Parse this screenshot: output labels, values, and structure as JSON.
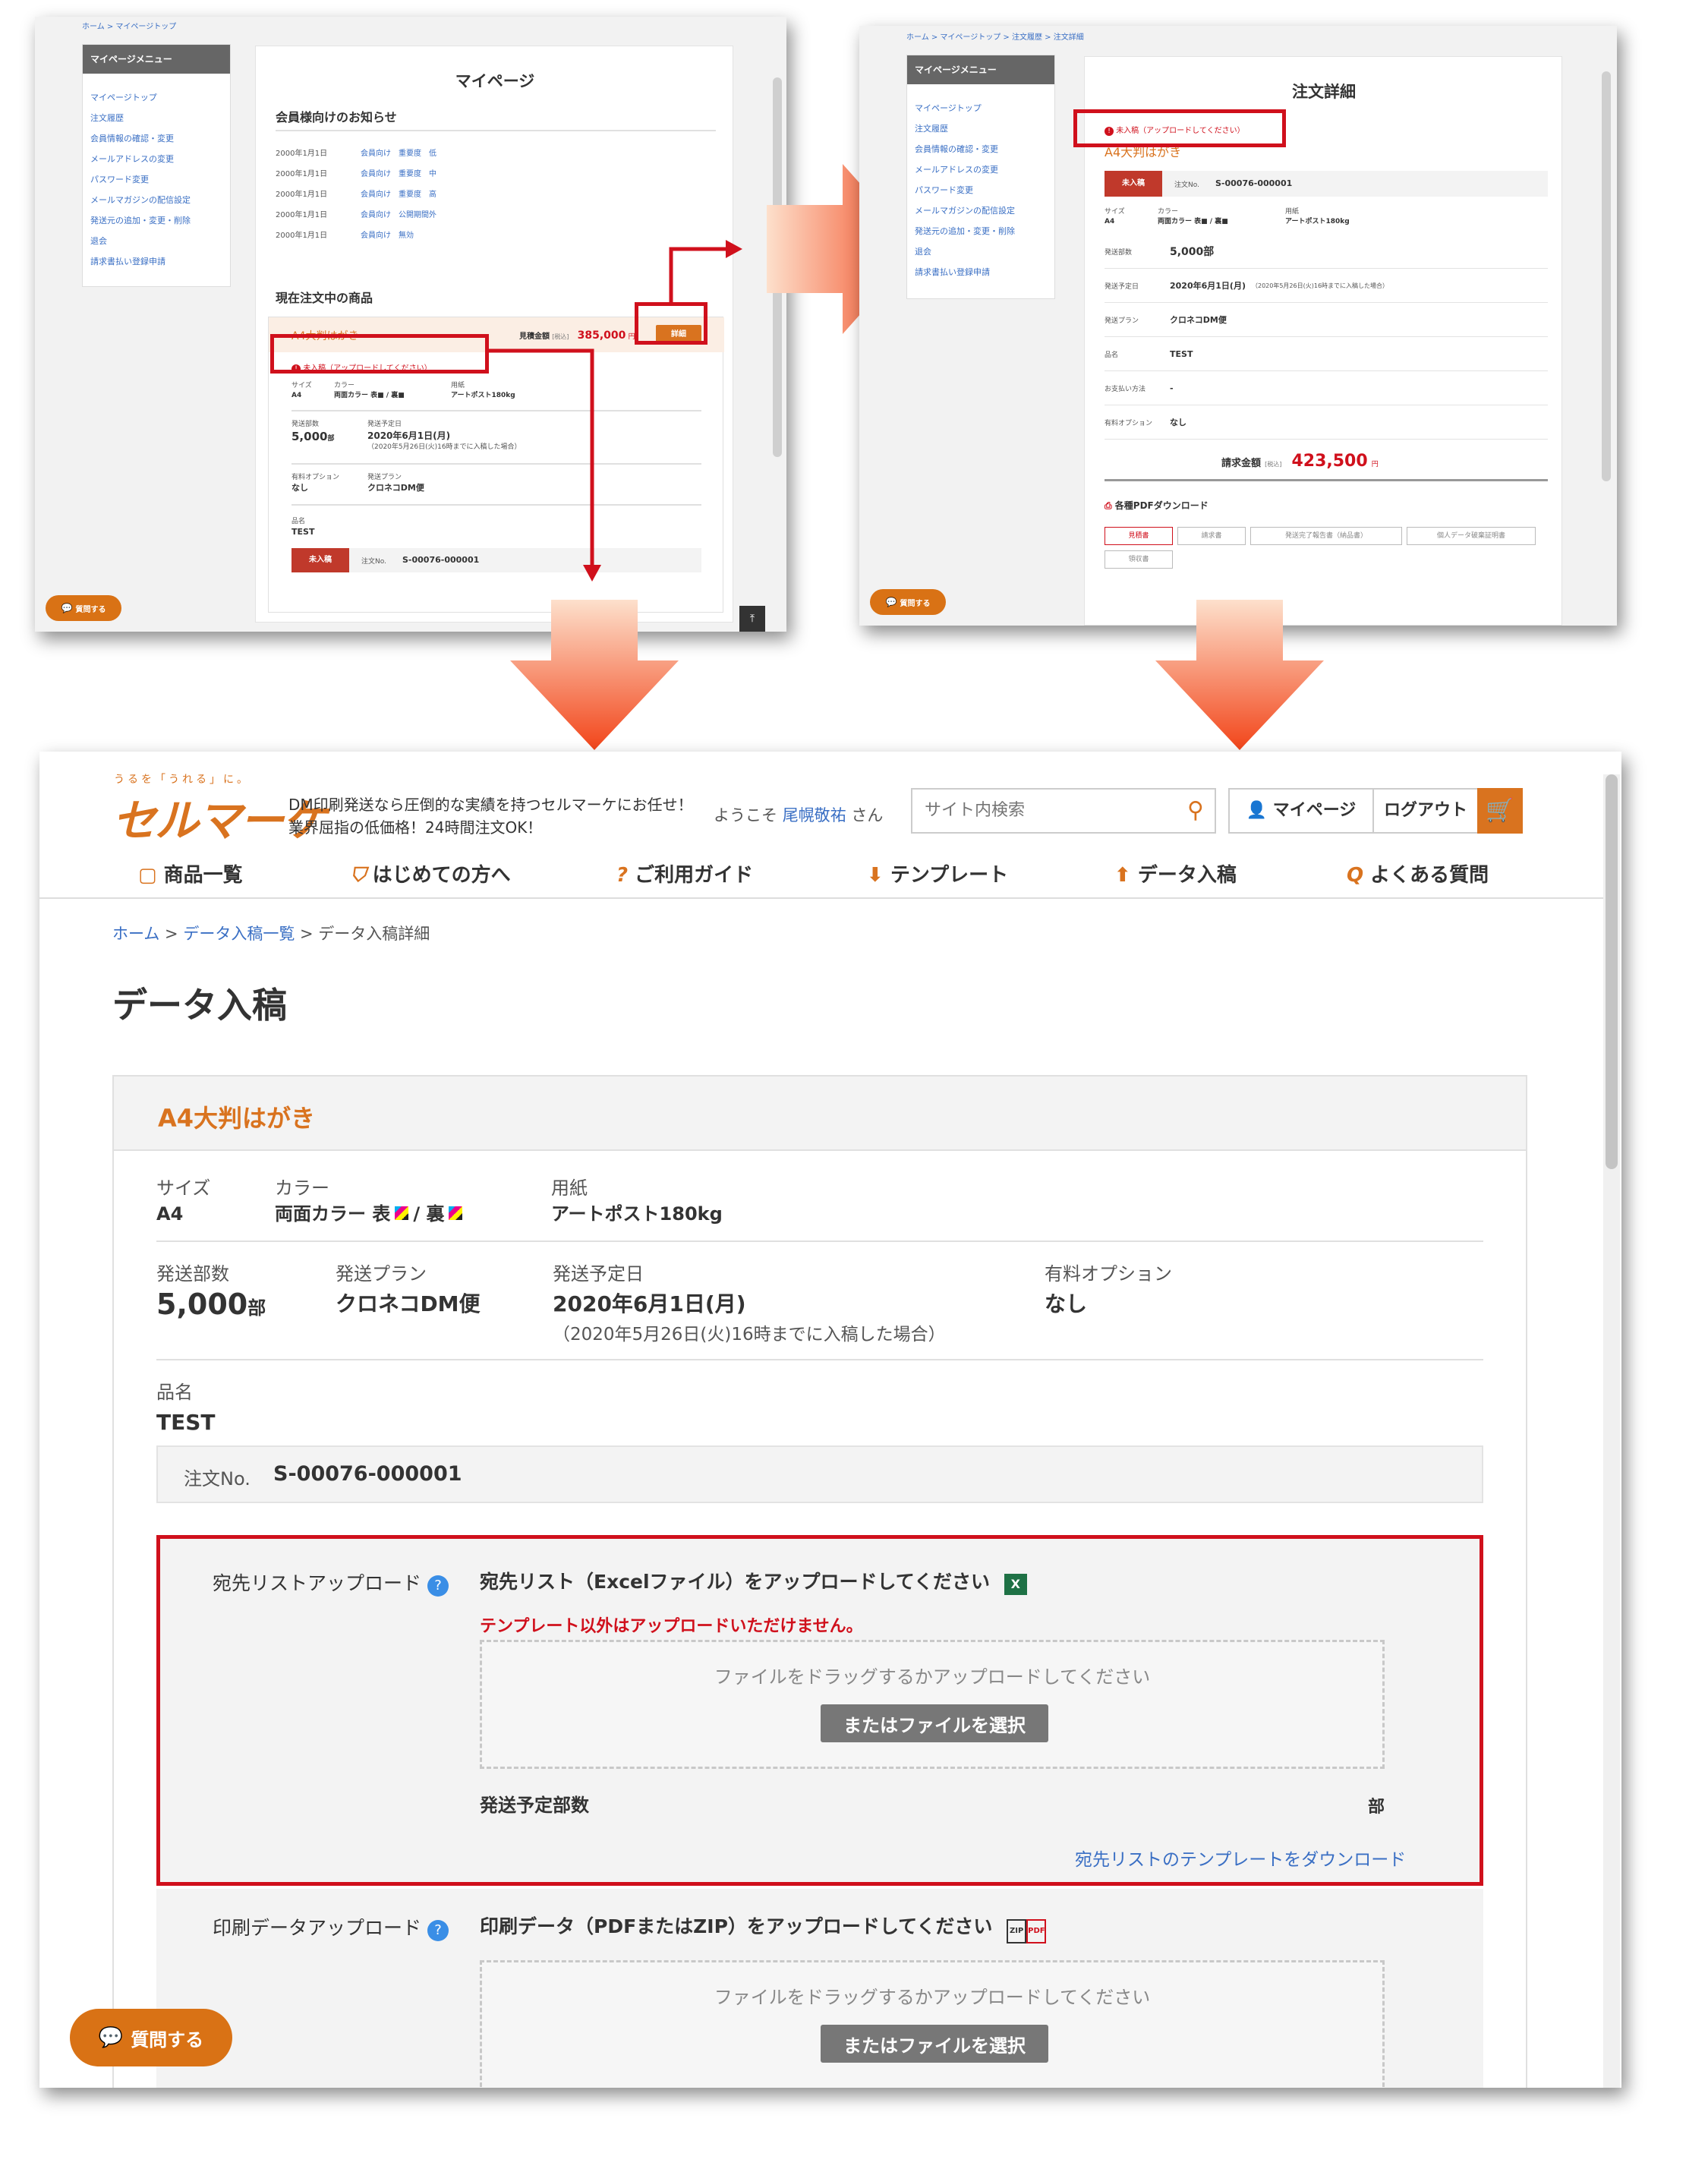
{
  "colors": {
    "brand": "#d9731f",
    "red_highlight": "#d0101c",
    "link": "#3a6fc4",
    "arrow": "#f24a1a"
  },
  "shot1": {
    "breadcrumb": "ホーム > マイページトップ",
    "menu_title": "マイページメニュー",
    "menu": [
      "マイページトップ",
      "注文履歴",
      "会員情報の確認・変更",
      "メールアドレスの変更",
      "パスワード変更",
      "メールマガジンの配信設定",
      "発送元の追加・変更・削除",
      "退会",
      "請求書払い登録申請"
    ],
    "title": "マイページ",
    "news_title": "会員様向けのお知らせ",
    "news": [
      {
        "date": "2000年1月1日",
        "text": "会員向け　重要度　低"
      },
      {
        "date": "2000年1月1日",
        "text": "会員向け　重要度　中"
      },
      {
        "date": "2000年1月1日",
        "text": "会員向け　重要度　高"
      },
      {
        "date": "2000年1月1日",
        "text": "会員向け　公開期間外"
      },
      {
        "date": "2000年1月1日",
        "text": "会員向け　無効"
      }
    ],
    "current_title": "現在注文中の商品",
    "product": "A4大判はがき",
    "estimate_label": "見積金額",
    "tax_label": "[税込]",
    "estimate": "385,000",
    "yen": "円",
    "detail_btn": "詳細",
    "status": "未入稿（アップロードしてください）",
    "size_label": "サイズ",
    "size": "A4",
    "color_label": "カラー",
    "color": "両面カラー 表■ / 裏■",
    "paper_label": "用紙",
    "paper": "アートポスト180kg",
    "qty_label": "発送部数",
    "qty": "5,000",
    "qty_unit": "部",
    "ship_label": "発送予定日",
    "ship": "2020年6月1日(月)",
    "ship_note": "（2020年5月26日(火)16時までに入稿した場合）",
    "opt_label": "有料オプション",
    "opt": "なし",
    "plan_label": "発送プラン",
    "plan": "クロネコDM便",
    "name_label": "品名",
    "name": "TEST",
    "badge": "未入稿",
    "order_label": "注文No.",
    "order_no": "S-00076-000001",
    "question": "質問する"
  },
  "shot2": {
    "breadcrumb": "ホーム > マイページトップ > 注文履歴 > 注文詳細",
    "menu_title": "マイページメニュー",
    "menu": [
      "マイページトップ",
      "注文履歴",
      "会員情報の確認・変更",
      "メールアドレスの変更",
      "パスワード変更",
      "メールマガジンの配信設定",
      "発送元の追加・変更・削除",
      "退会",
      "請求書払い登録申請"
    ],
    "title": "注文詳細",
    "status": "未入稿（アップロードしてください）",
    "product": "A4大判はがき",
    "badge": "未入稿",
    "order_label": "注文No.",
    "order_no": "S-00076-000001",
    "size_label": "サイズ",
    "size": "A4",
    "color_label": "カラー",
    "color": "両面カラー 表■ / 裏■",
    "paper_label": "用紙",
    "paper": "アートポスト180kg",
    "rows": [
      {
        "label": "発送部数",
        "value": "5,000部"
      },
      {
        "label": "発送予定日",
        "value": "2020年6月1日(月)",
        "note": "（2020年5月26日(火)16時までに入稿した場合）"
      },
      {
        "label": "発送プラン",
        "value": "クロネコDM便"
      },
      {
        "label": "品名",
        "value": "TEST"
      },
      {
        "label": "お支払い方法",
        "value": "-"
      },
      {
        "label": "有料オプション",
        "value": "なし"
      }
    ],
    "total_label": "請求金額",
    "tax_label": "[税込]",
    "total": "423,500",
    "yen": "円",
    "pdf_title": "各種PDFダウンロード",
    "pdf_buttons": [
      "見積書",
      "請求書",
      "発送完了報告書（納品書）",
      "個人データ破棄証明書",
      "領収書"
    ],
    "question": "質問する"
  },
  "main": {
    "tagline_small": "うるを「うれる」に。",
    "logo": "セルマーケ",
    "catch1": "DM印刷発送なら圧倒的な実績を持つセルマーケにお任せ！",
    "catch2": "業界屈指の低価格！24時間注文OK！",
    "welcome_pre": "ようこそ",
    "welcome_name": "尾幌敬祐",
    "welcome_post": "さん",
    "search_placeholder": "サイト内検索",
    "mypage": "マイページ",
    "logout": "ログアウト",
    "nav": [
      "商品一覧",
      "はじめての方へ",
      "ご利用ガイド",
      "テンプレート",
      "データ入稿",
      "よくある質問"
    ],
    "breadcrumb": [
      "ホーム",
      "データ入稿一覧",
      "データ入稿詳細"
    ],
    "page_title": "データ入稿",
    "product": "A4大判はがき",
    "size_label": "サイズ",
    "size": "A4",
    "color_label": "カラー",
    "color_front": "両面カラー 表",
    "color_back": "/ 裏",
    "paper_label": "用紙",
    "paper": "アートポスト180kg",
    "qty_label": "発送部数",
    "qty": "5,000",
    "qty_unit": "部",
    "plan_label": "発送プラン",
    "plan": "クロネコDM便",
    "ship_label": "発送予定日",
    "ship": "2020年6月1日(月)",
    "ship_note": "（2020年5月26日(火)16時までに入稿した場合）",
    "opt_label": "有料オプション",
    "opt": "なし",
    "name_label": "品名",
    "name": "TEST",
    "order_label": "注文No.",
    "order_no": "S-00076-000001",
    "list_upload_label": "宛先リストアップロード",
    "list_upload_title": "宛先リスト（Excelファイル）をアップロードしてください",
    "list_warning": "テンプレート以外はアップロードいただけません。",
    "drop_text": "ファイルをドラッグするかアップロードしてください",
    "select_btn": "またはファイルを選択",
    "planned_qty_label": "発送予定部数",
    "planned_qty_unit": "部",
    "template_link": "宛先リストのテンプレートをダウンロード",
    "print_upload_label": "印刷データアップロード",
    "print_upload_title": "印刷データ（PDFまたはZIP）をアップロードしてください",
    "question": "質問する"
  }
}
